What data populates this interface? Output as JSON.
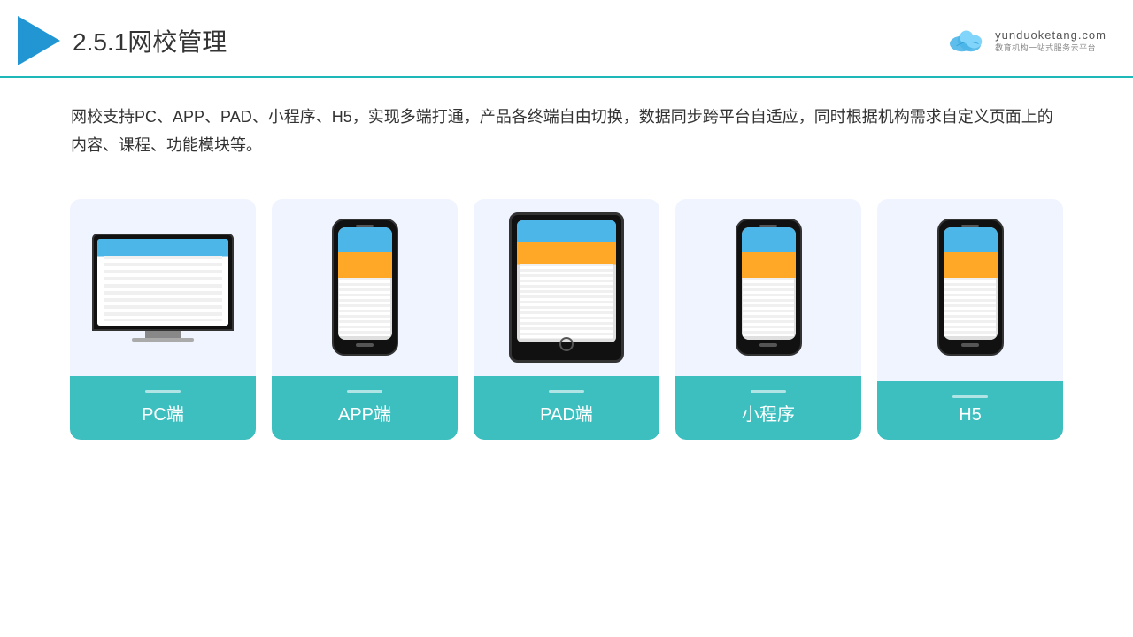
{
  "header": {
    "title_number": "2.5.1",
    "title_text": "网校管理",
    "brand_name": "yunduoketang.com",
    "brand_tagline": "教育机构一站式服务云平台"
  },
  "description": {
    "text": "网校支持PC、APP、PAD、小程序、H5，实现多端打通，产品各终端自由切换，数据同步跨平台自适应，同时根据机构需求自定义页面上的内容、课程、功能模块等。"
  },
  "cards": [
    {
      "id": "pc",
      "label": "PC端",
      "device": "pc"
    },
    {
      "id": "app",
      "label": "APP端",
      "device": "phone"
    },
    {
      "id": "pad",
      "label": "PAD端",
      "device": "tablet"
    },
    {
      "id": "miniprogram",
      "label": "小程序",
      "device": "phone"
    },
    {
      "id": "h5",
      "label": "H5",
      "device": "phone"
    }
  ],
  "accent_color": "#3ebfbf"
}
